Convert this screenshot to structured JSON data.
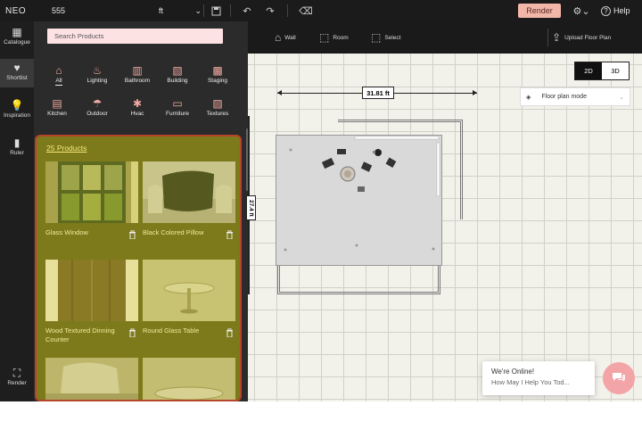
{
  "topbar": {
    "logo": "NEO",
    "project_name": "555",
    "unit": "ft",
    "render_label": "Render",
    "help_label": "Help"
  },
  "rail": {
    "items": [
      {
        "label": "Catalogue",
        "icon": "catalogue-icon"
      },
      {
        "label": "Shortlist",
        "icon": "shortlist-icon"
      },
      {
        "label": "Inspiration",
        "icon": "lightbulb-icon"
      },
      {
        "label": "Ruler",
        "icon": "ruler-icon"
      },
      {
        "label": "Render",
        "icon": "render-icon"
      }
    ],
    "active": "Shortlist"
  },
  "search": {
    "placeholder": "Search Products"
  },
  "categories": [
    {
      "label": "All",
      "icon": "all-icon"
    },
    {
      "label": "Lighting",
      "icon": "lamp-icon"
    },
    {
      "label": "Bathroom",
      "icon": "door-icon"
    },
    {
      "label": "Building",
      "icon": "building-icon"
    },
    {
      "label": "Staging",
      "icon": "staging-icon"
    },
    {
      "label": "Kitchen",
      "icon": "kitchen-icon"
    },
    {
      "label": "Outdoor",
      "icon": "outdoor-icon"
    },
    {
      "label": "Hvac",
      "icon": "hvac-icon"
    },
    {
      "label": "Furniture",
      "icon": "sofa-icon"
    },
    {
      "label": "Textures",
      "icon": "textures-icon"
    }
  ],
  "products": {
    "count_label": "25 Products",
    "items": [
      {
        "name": "Glass Window"
      },
      {
        "name": "Black Colored Pillow"
      },
      {
        "name": "Wood Textured Dinning Counter"
      },
      {
        "name": "Round Glass Table"
      },
      {
        "name": ""
      },
      {
        "name": ""
      }
    ]
  },
  "toolbar": {
    "wall_label": "Wall",
    "room_label": "Room",
    "select_label": "Select",
    "upload_label": "Upload Floor Plan"
  },
  "canvas": {
    "view_2d": "2D",
    "view_3d": "3D",
    "active_view": "2D",
    "mode_label": "Floor plan mode",
    "width_dim": "31.81 ft",
    "height_dim": "27.4 ft"
  },
  "chat": {
    "title": "We're Online!",
    "subtitle": "How May I Help You Tod..."
  },
  "colors": {
    "accent": "#f3b7aa",
    "panel_highlight": "#7c7a1a",
    "highlight_border": "#b5442a"
  }
}
